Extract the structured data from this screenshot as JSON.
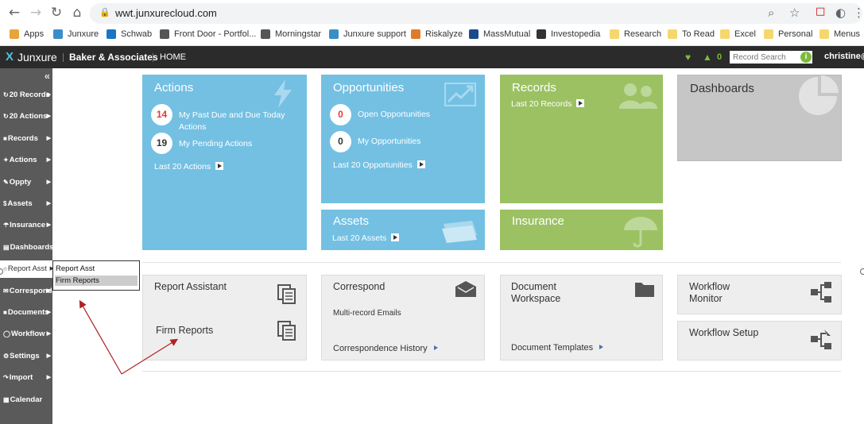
{
  "browser": {
    "url": "wwt.junxurecloud.com"
  },
  "bookmarks": [
    {
      "label": "Apps",
      "color": "#e8a33a"
    },
    {
      "label": "Junxure",
      "color": "#3a8ec8"
    },
    {
      "label": "Schwab",
      "color": "#1a75c7"
    },
    {
      "label": "Front Door - Portfol...",
      "color": "#555555"
    },
    {
      "label": "Morningstar",
      "color": "#555555"
    },
    {
      "label": "Junxure support",
      "color": "#3a8ec8"
    },
    {
      "label": "Riskalyze",
      "color": "#e07b2a"
    },
    {
      "label": "MassMutual",
      "color": "#1a4b8c"
    },
    {
      "label": "Investopedia",
      "color": "#333333"
    },
    {
      "label": "Research",
      "color": "#f5d76e"
    },
    {
      "label": "To Read",
      "color": "#f5d76e"
    },
    {
      "label": "Excel",
      "color": "#f5d76e"
    },
    {
      "label": "Personal",
      "color": "#f5d76e"
    },
    {
      "label": "Menus",
      "color": "#f5d76e"
    }
  ],
  "topbar": {
    "logo": "Junxure",
    "company": "Baker & Associates",
    "page": "HOME",
    "notification_count": "0",
    "search_placeholder": "Record Search",
    "user": "christine@"
  },
  "sidebar": {
    "items": [
      {
        "label": "20 Records"
      },
      {
        "label": "20 Actions"
      },
      {
        "label": "Records"
      },
      {
        "label": "Actions"
      },
      {
        "label": "Oppty"
      },
      {
        "label": "Assets"
      },
      {
        "label": "Insurance"
      },
      {
        "label": "Dashboards"
      },
      {
        "label": "Report Asst"
      },
      {
        "label": "Correspond"
      },
      {
        "label": "Documents"
      },
      {
        "label": "Workflow"
      },
      {
        "label": "Settings"
      },
      {
        "label": "Import"
      },
      {
        "label": "Calendar"
      }
    ],
    "popup": [
      "Report Asst",
      "Firm Reports"
    ]
  },
  "tiles": {
    "actions": {
      "title": "Actions",
      "past_due_count": "14",
      "past_due_label": "My Past Due and Due Today Actions",
      "pending_count": "19",
      "pending_label": "My Pending Actions",
      "last_link": "Last 20 Actions"
    },
    "opportunities": {
      "title": "Opportunities",
      "open_count": "0",
      "open_label": "Open Opportunities",
      "my_count": "0",
      "my_label": "My Opportunities",
      "last_link": "Last 20 Opportunities"
    },
    "records": {
      "title": "Records",
      "last_link": "Last 20 Records"
    },
    "dashboards": {
      "title": "Dashboards"
    },
    "assets": {
      "title": "Assets",
      "last_link": "Last 20 Assets"
    },
    "insurance": {
      "title": "Insurance"
    }
  },
  "lower": {
    "report_assistant": "Report Assistant",
    "firm_reports": "Firm Reports",
    "correspond": "Correspond",
    "multi_record": "Multi-record Emails",
    "correspondence_history": "Correspondence History",
    "document_workspace": "Document Workspace",
    "document_templates": "Document Templates",
    "workflow_monitor": "Workflow Monitor",
    "workflow_setup": "Workflow Setup"
  },
  "colors": {
    "blue_tile": "#74c0e3",
    "green_tile": "#9cc163",
    "gray_tile": "#c6c6c6",
    "sidebar": "#5a5a5a",
    "topbar": "#2b2b2b",
    "annotation_arrow": "#b22222"
  }
}
